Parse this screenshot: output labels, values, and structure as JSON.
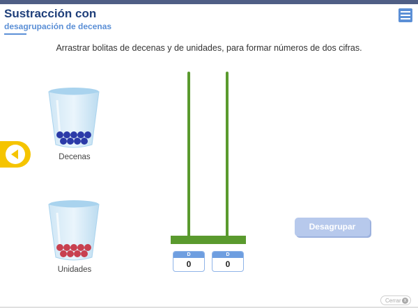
{
  "header": {
    "title": "Sustracción con",
    "subtitle": "desagrupación de decenas"
  },
  "instructions": "Arrastrar bolitas de decenas y de unidades, para formar números de dos cifras.",
  "cups": {
    "decenas_label": "Decenas",
    "unidades_label": "Unidades",
    "decenas_ball_color": "#2b3aa8",
    "unidades_ball_color": "#c8404f"
  },
  "abacus": {
    "left_header": "D",
    "left_value": "0",
    "right_header": "D",
    "right_value": "0",
    "pole_color": "#5a9a2e"
  },
  "buttons": {
    "desagrupar_label": "Desagrupar",
    "cerrar_label": "Cerrar",
    "cerrar_icon": "x"
  },
  "colors": {
    "accent": "#5b8fd6",
    "title": "#1f3f7a",
    "back_button": "#f5c400"
  }
}
